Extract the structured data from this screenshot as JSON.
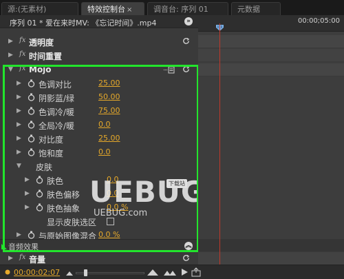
{
  "tabs": [
    {
      "label": "源:(无素材)",
      "active": false
    },
    {
      "label": "特效控制台",
      "active": true,
      "close": "×"
    },
    {
      "label": "调音台: 序列 01",
      "active": false
    },
    {
      "label": "元数据",
      "active": false
    }
  ],
  "header": {
    "title": "序列 01 * 爱在来时MV: 《忘记时间》.mp4",
    "end_icon": "double-chevron-icon"
  },
  "timeline": {
    "timecode_ruler": "00:00;05:00"
  },
  "effects_top": [
    {
      "label": "透明度"
    },
    {
      "label": "时间重置"
    }
  ],
  "mojo": {
    "label": "Mojo",
    "params": [
      {
        "label": "色调对比",
        "value": "25.00"
      },
      {
        "label": "阴影蓝/绿",
        "value": "50.00"
      },
      {
        "label": "色调冷/暖",
        "value": "75.00"
      },
      {
        "label": "全局冷/暖",
        "value": "0.0"
      },
      {
        "label": "对比度",
        "value": "25.00"
      },
      {
        "label": "饱和度",
        "value": "0.0"
      }
    ],
    "skin": {
      "label": "皮肤",
      "params": [
        {
          "label": "肤色",
          "value": "0.0"
        },
        {
          "label": "肤色偏移",
          "value": "0.0"
        },
        {
          "label": "肤色抽象",
          "value": "0.0 %"
        }
      ],
      "show_selection": "显示皮肤选区"
    },
    "blend": {
      "label": "与原始图像混合",
      "value": "0.0 %"
    }
  },
  "audio_effects": {
    "label": "音频效果"
  },
  "volume": {
    "label": "音量"
  },
  "footer": {
    "timecode": "00:00:02:07"
  },
  "watermark": {
    "brand": "UEBUG.com",
    "badge": "下载站"
  },
  "colors": {
    "highlight_box": "#22e52c",
    "value_accent": "#e6a92a",
    "playhead": "#c0392b"
  }
}
